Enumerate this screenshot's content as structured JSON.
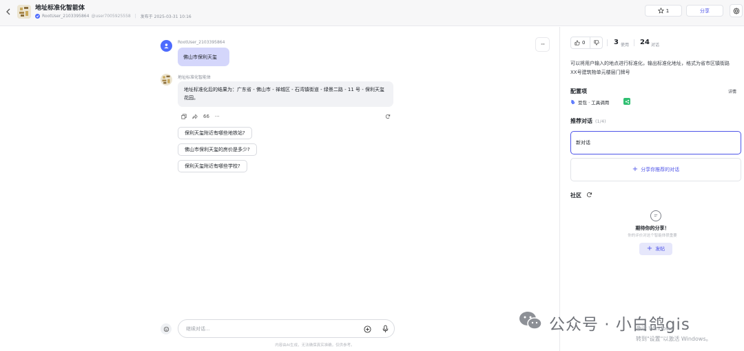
{
  "header": {
    "title": "地址标准化智能体",
    "author": "RootUser_2103395864",
    "author_id": "@user7005925558",
    "published": "发布于 2025-03-31 10:16",
    "favorite_count": "1",
    "share_label": "分享"
  },
  "chat": {
    "user_name": "RootUser_2103395864",
    "user_message": "佛山市保利天玺",
    "bot_name": "地址标准化智能体",
    "bot_message": "地址标准化后的结果为：广东省 - 佛山市 - 禅城区 - 石湾镇街道 - 绿景二路 - 11 号 - 保利天玺花园。",
    "quote_icon": "66",
    "more_dots": "···",
    "suggestions": [
      "保利天玺附近有哪些地铁站?",
      "佛山市保利天玺的房价是多少?",
      "保利天玺附近有哪些学校?"
    ],
    "input_placeholder": "继续对话...",
    "disclaimer": "内容由AI生成，无法确保真实准确，仅供参考。"
  },
  "sidebar": {
    "like_count": "0",
    "usage_num": "3",
    "usage_label": "使用",
    "conv_num": "24",
    "conv_label": "对话",
    "description": "可以将用户输入的地点进行标准化，输出标准化地址，格式为省市区镇街路XX号建筑物单元楼层门牌号",
    "config_title": "配置项",
    "config_detail": "详情",
    "plugin_label": "豆包 · 工具调用",
    "rec_title": "推荐对话",
    "rec_count": "(1/4)",
    "new_conv": "新对话",
    "share_rec": "分享你推荐的对话",
    "community_title": "社区",
    "empty_title": "期待你的分享！",
    "empty_sub": "你的评价对这个智能体很重要",
    "post_label": "发帖"
  },
  "watermark": {
    "text": "公众号 · 小白鸽gis",
    "win_line1": "激活 Windows",
    "win_line2": "转到\"设置\"以激活 Windows。"
  },
  "colors": {
    "accent": "#4d53e8",
    "user_bubble": "#d4d6fb",
    "bot_bubble": "#f1f2f5",
    "header_bg": "#f7f7f8"
  }
}
